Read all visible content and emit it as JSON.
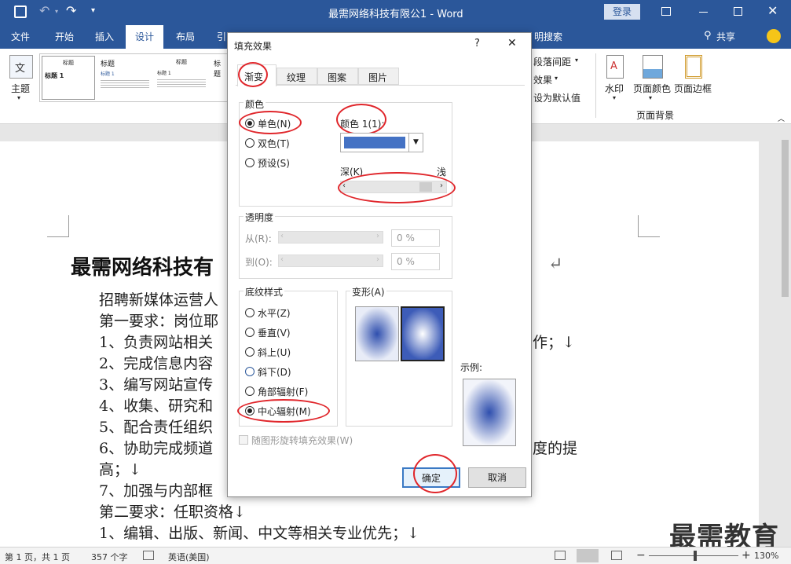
{
  "titlebar": {
    "title": "最需网络科技有限公1  -  Word",
    "login": "登录"
  },
  "tabs": [
    "文件",
    "开始",
    "插入",
    "设计",
    "布局",
    "引"
  ],
  "tell_me": "明搜索",
  "share": "共享",
  "ribbon": {
    "theme_label": "主题",
    "theme_icon_text": "文",
    "gallery": [
      {
        "title": "标题",
        "h1": "标题 1"
      },
      {
        "title": "标题",
        "h1": "标题 1"
      },
      {
        "title": "标题",
        "h1": "标题 1"
      },
      {
        "title": "标题",
        "h1": "标题 1"
      }
    ],
    "paragraph_spacing": "段落间距",
    "effects": "效果",
    "set_default": "设为默认值",
    "watermark": "水印",
    "page_color": "页面颜色",
    "page_border": "页面边框",
    "page_background_group": "页面背景"
  },
  "document": {
    "heading": "最需网络科技有",
    "lines": [
      "招聘新媒体运营人",
      "第一要求：岗位耶",
      "1、负责网站相关",
      "2、完成信息内容",
      "3、编写网站宣传",
      "4、收集、研究和",
      "5、配合责任组织",
      "6、协助完成频道",
      "高；↓",
      "7、加强与内部框",
      "第二要求：任职资格↓",
      "1、编辑、出版、新闻、中文等相关专业优先；↓"
    ],
    "right_line3": "作；↓",
    "right_line8": "度的提",
    "return_mark": "↵"
  },
  "dialog": {
    "title": "填充效果",
    "help": "?",
    "close": "✕",
    "tabs": [
      "渐变",
      "纹理",
      "图案",
      "图片"
    ],
    "color_group": "颜色",
    "radio_single": "单色(N)",
    "radio_double": "双色(T)",
    "radio_preset": "预设(S)",
    "color1_label": "颜色 1(1):",
    "color1_value": "#4472c4",
    "dark_label": "深(K)",
    "light_label": "浅",
    "transparency_group": "透明度",
    "from_label": "从(R):",
    "to_label": "到(O):",
    "from_value": "0 %",
    "to_value": "0 %",
    "shading_group": "底纹样式",
    "shading_options": [
      "水平(Z)",
      "垂直(V)",
      "斜上(U)",
      "斜下(D)",
      "角部辐射(F)",
      "中心辐射(M)"
    ],
    "variants_group": "变形(A)",
    "sample_label": "示例:",
    "rotate_checkbox": "随图形旋转填充效果(W)",
    "ok": "确定",
    "cancel": "取消"
  },
  "statusbar": {
    "page": "第 1 页，共 1 页",
    "words": "357 个字",
    "language": "英语(美国)",
    "zoom": "130%",
    "minus": "−",
    "plus": "+"
  },
  "watermark_brand": "最需教育",
  "colors": {
    "word_blue": "#2b579a",
    "accent_red": "#e0262b",
    "gradient_blue": "#3d5cb8"
  }
}
